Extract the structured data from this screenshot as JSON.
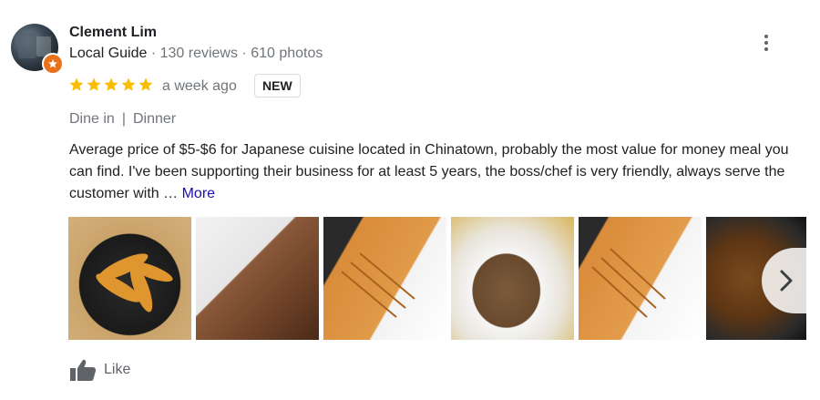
{
  "reviewer": {
    "name": "Clement Lim",
    "role": "Local Guide",
    "reviews": "130 reviews",
    "photos": "610 photos",
    "separator": " · "
  },
  "rating": {
    "stars": 5,
    "max_stars": 5,
    "time_ago": "a week ago",
    "badge": "NEW"
  },
  "tags": {
    "dine": "Dine in",
    "separator": "|",
    "meal": "Dinner"
  },
  "review": {
    "text": "Average price of $5-$6 for Japanese cuisine located in Chinatown, probably the most value for money meal you can find. I've been supporting their business for at least 5 years, the boss/chef is very friendly, always serve the customer with … ",
    "more_label": "More"
  },
  "colors": {
    "star": "#fbbc04",
    "link": "#1a0dab",
    "guide_badge": "#e8711a",
    "muted_text": "#70757a"
  },
  "icons": {
    "more_menu": "more-vert-icon",
    "next": "chevron-right-icon",
    "like": "thumbs-up-icon",
    "star": "star-icon",
    "guide": "local-guide-icon"
  },
  "actions": {
    "like_label": "Like"
  }
}
